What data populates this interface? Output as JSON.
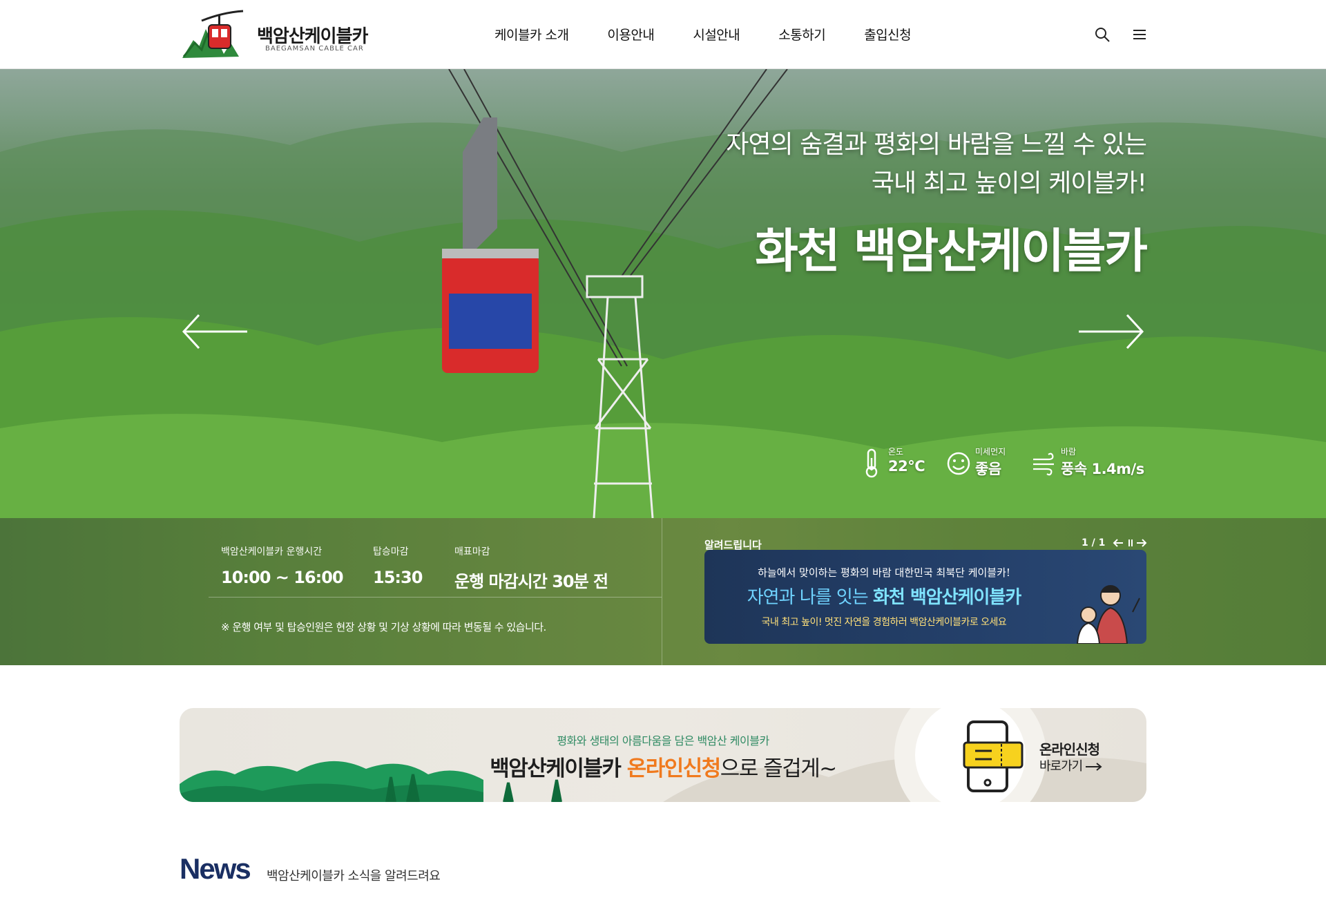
{
  "header": {
    "logo_name": "백암산케이블카",
    "logo_sub": "BAEGAMSAN CABLE CAR",
    "nav": [
      "케이블카 소개",
      "이용안내",
      "시설안내",
      "소통하기",
      "출입신청"
    ],
    "icons": [
      "search-icon",
      "menu-icon"
    ]
  },
  "hero": {
    "line1": "자연의 숨결과 평화의 바람을 느낄 수 있는",
    "line2": "국내 최고 높이의 케이블카!",
    "big": "화천 백암산케이블카",
    "weather": [
      {
        "label": "온도",
        "value": "22°C",
        "icon": "thermometer-icon"
      },
      {
        "label": "미세먼지",
        "value": "좋음",
        "icon": "smile-icon"
      },
      {
        "label": "바람",
        "value": "풍속 1.4m/s",
        "icon": "wind-icon"
      }
    ]
  },
  "info": {
    "hours_label": "백암산케이블카 운행시간",
    "hours_value": "10:00 ~ 16:00",
    "boarding_label": "탑승마감",
    "boarding_value": "15:30",
    "ticket_label": "매표마감",
    "ticket_value": "운행 마감시간 30분 전",
    "note": "※ 운행 여부 및 탑승인원은 현장 상황 및 기상 상황에 따라 변동될 수 있습니다."
  },
  "notice": {
    "title": "알려드립니다",
    "pager": "1 / 1",
    "card_top": "하늘에서 맞이하는 평화의 바람 대한민국 최북단 케이블카!",
    "card_mid_a": "자연과 나를 잇는 ",
    "card_mid_b": "화천 백암산케이블카",
    "card_bot": "국내 최고 높이! 멋진 자연을 경험하러 백암산케이블카로 오세요"
  },
  "online": {
    "sub": "평화와 생태의 아름다움을 담은 백암산 케이블카",
    "main_a": "백암산케이블카 ",
    "main_b": "온라인신청",
    "main_c": "으로 즐겁게~",
    "cta1": "온라인신청",
    "cta2": "바로가기"
  },
  "news": {
    "title": "News",
    "sub": "백암산케이블카 소식을 알려드려요"
  },
  "colors": {
    "brand_red": "#d92b2b",
    "online_orange": "#f07a1e",
    "news_navy": "#1a2f63",
    "notice_bg": "#1e3558"
  }
}
